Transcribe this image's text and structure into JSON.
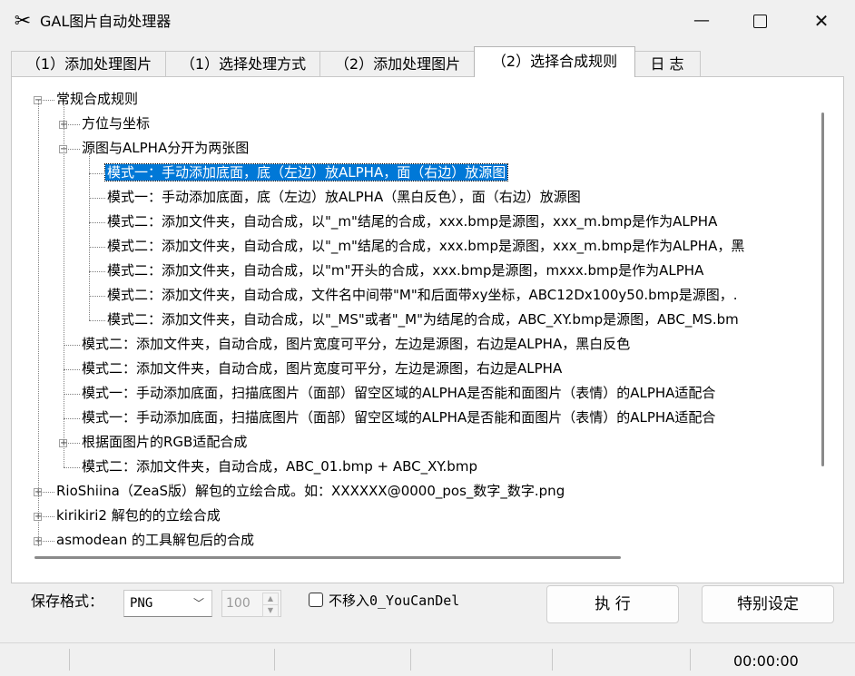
{
  "window": {
    "title": "GAL图片自动处理器",
    "minimize": "—",
    "close": "✕"
  },
  "tabs": [
    {
      "label": "（1）添加处理图片"
    },
    {
      "label": "（1）选择处理方式"
    },
    {
      "label": "（2）添加处理图片"
    },
    {
      "label": "（2）选择合成规则",
      "active": true
    },
    {
      "label": "日 志"
    }
  ],
  "tree": [
    {
      "label": "常规合成规则",
      "level": 0,
      "expander": "minus"
    },
    {
      "label": "方位与坐标",
      "level": 1,
      "expander": "plus"
    },
    {
      "label": "源图与ALPHA分开为两张图",
      "level": 1,
      "expander": "minus"
    },
    {
      "label": "模式一：手动添加底面，底（左边）放ALPHA，面（右边）放源图",
      "level": 2,
      "selected": true
    },
    {
      "label": "模式一：手动添加底面，底（左边）放ALPHA（黑白反色），面（右边）放源图",
      "level": 2
    },
    {
      "label": "模式二：添加文件夹，自动合成，以\"_m\"结尾的合成，xxx.bmp是源图，xxx_m.bmp是作为ALPHA",
      "level": 2
    },
    {
      "label": "模式二：添加文件夹，自动合成，以\"_m\"结尾的合成，xxx.bmp是源图，xxx_m.bmp是作为ALPHA，黑",
      "level": 2
    },
    {
      "label": "模式二：添加文件夹，自动合成，以\"m\"开头的合成，xxx.bmp是源图，mxxx.bmp是作为ALPHA",
      "level": 2
    },
    {
      "label": "模式二：添加文件夹，自动合成，文件名中间带\"M\"和后面带xy坐标，ABC12Dx100y50.bmp是源图，.",
      "level": 2
    },
    {
      "label": "模式二：添加文件夹，自动合成，以\"_MS\"或者\"_M\"为结尾的合成，ABC_XY.bmp是源图，ABC_MS.bm",
      "level": 2
    },
    {
      "label": "模式二：添加文件夹，自动合成，图片宽度可平分，左边是源图，右边是ALPHA，黑白反色",
      "level": 1
    },
    {
      "label": "模式二：添加文件夹，自动合成，图片宽度可平分，左边是源图，右边是ALPHA",
      "level": 1
    },
    {
      "label": "模式一：手动添加底面，扫描底图片（面部）留空区域的ALPHA是否能和面图片（表情）的ALPHA适配合",
      "level": 1
    },
    {
      "label": "模式一：手动添加底面，扫描底图片（面部）留空区域的ALPHA是否能和面图片（表情）的ALPHA适配合",
      "level": 1
    },
    {
      "label": "根据面图片的RGB适配合成",
      "level": 1,
      "expander": "plus"
    },
    {
      "label": "模式二：添加文件夹，自动合成，ABC_01.bmp + ABC_XY.bmp",
      "level": 1
    },
    {
      "label": "RioShiina（ZeaS版）解包的立绘合成。如：XXXXXX@0000_pos_数字_数字.png",
      "level": 0,
      "expander": "plus"
    },
    {
      "label": "kirikiri2 解包的的立绘合成",
      "level": 0,
      "expander": "plus"
    },
    {
      "label": "asmodean 的工具解包后的合成",
      "level": 0,
      "expander": "plus"
    }
  ],
  "bottom": {
    "format_label": "保存格式：",
    "format_value": "PNG",
    "quality_value": "100",
    "checkbox_label": "不移入0_YouCanDel",
    "execute_button": "执 行",
    "settings_button": "特别设定"
  },
  "status": {
    "time": "00:00:00"
  }
}
